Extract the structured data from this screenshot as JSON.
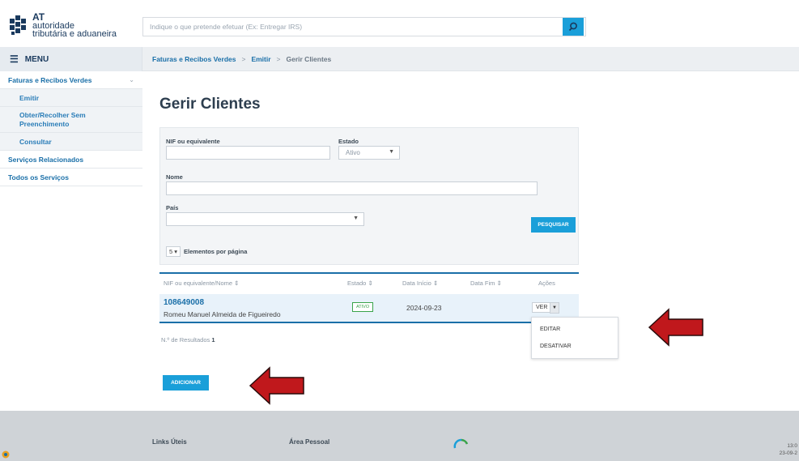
{
  "brand": {
    "logo_line1": "AT",
    "logo_line2": "autoridade",
    "logo_line3": "tributária e aduaneira",
    "accent": "#1a9fd9",
    "navy": "#1a3a5e",
    "link": "#1a6fa8",
    "active_green": "#3aa34a",
    "arrow_red": "#c0181c"
  },
  "search": {
    "placeholder": "Indique o que pretende efetuar (Ex: Entregar IRS)",
    "icon": "search-icon"
  },
  "menu": {
    "label": "MENU",
    "icon": "hamburger-icon"
  },
  "breadcrumb": {
    "items": [
      "Faturas e Recibos Verdes",
      "Emitir",
      "Gerir Clientes"
    ],
    "separator": ">"
  },
  "sidebar": {
    "items": [
      {
        "label": "Faturas e Recibos Verdes",
        "level": 0
      },
      {
        "label": "Emitir",
        "level": 1
      },
      {
        "label": "Obter/Recolher Sem",
        "label2": "Preenchimento",
        "level": 1
      },
      {
        "label": "Consultar",
        "level": 1
      },
      {
        "label": "Serviços Relacionados",
        "level": 0
      },
      {
        "label": "Todos os Serviços",
        "level": 0
      }
    ]
  },
  "page": {
    "title": "Gerir Clientes"
  },
  "filters": {
    "nif_label": "NIF ou equivalente",
    "nif_value": "",
    "estado_label": "Estado",
    "estado_value": "Ativo",
    "nome_label": "Nome",
    "nome_value": "",
    "pais_label": "País",
    "pais_value": "",
    "search_button": "PESQUISAR",
    "per_page_value": "5",
    "per_page_label": "Elementos por página"
  },
  "table": {
    "columns": [
      "NIF ou equivalente/Nome",
      "Estado",
      "Data Início",
      "Data Fim",
      "Ações"
    ],
    "sort_icon": "sort-icon",
    "rows": [
      {
        "nif": "108649008",
        "name": "Romeu Manuel Almeida de Figueiredo",
        "status": "ATIVO",
        "start": "2024-09-23",
        "end": "",
        "action": "VER"
      }
    ]
  },
  "dropdown": {
    "items": [
      "EDITAR",
      "DESATIVAR"
    ]
  },
  "results": {
    "label": "N.º de Resultados",
    "count": "1"
  },
  "add_button": "ADICIONAR",
  "footer": {
    "links_title": "Links Úteis",
    "area_title": "Área Pessoal"
  },
  "taskbar": {
    "time": "13:0",
    "date": "23-09-2"
  }
}
